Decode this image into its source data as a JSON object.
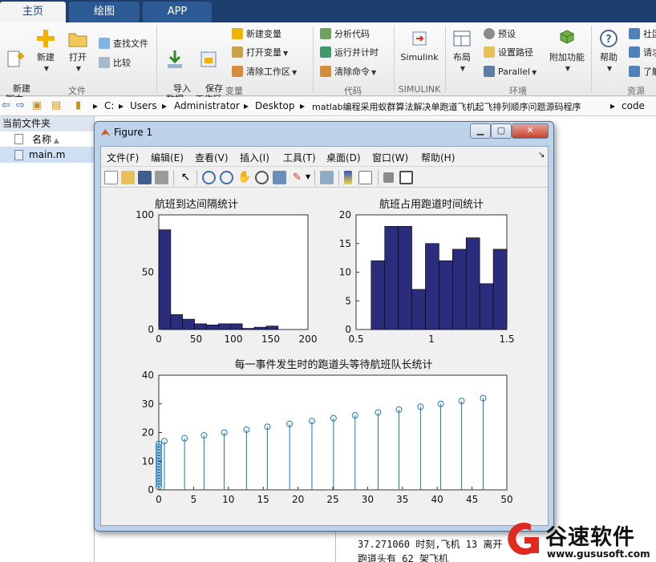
{
  "ribbon": {
    "tabs": [
      {
        "label": "主页",
        "active": true
      },
      {
        "label": "绘图",
        "active": false
      },
      {
        "label": "APP",
        "active": false
      }
    ],
    "buttons": {
      "new_script": "新建\n脚本",
      "new": "新建",
      "open": "打开",
      "find_files": "查找文件",
      "compare": "比较",
      "import_data": "导入\n数据",
      "save_workspace": "保存\n工作区",
      "new_variable": "新建变量",
      "open_variable": "打开变量",
      "clear_workspace": "清除工作区",
      "analyze_code": "分析代码",
      "run_and_time": "运行并计时",
      "clear_commands": "清除命令",
      "simulink": "Simulink",
      "layout": "布局",
      "preferences": "预设",
      "set_path": "设置路径",
      "parallel": "Parallel",
      "add_ons": "附加功能",
      "help": "帮助",
      "community": "社区",
      "request_support": "请求",
      "learn": "了解"
    },
    "groups": {
      "file": "文件",
      "variable": "变量",
      "code": "代码",
      "simulink": "SIMULINK",
      "environment": "环境",
      "resources": "资源"
    }
  },
  "address_bar": {
    "path": [
      "C:",
      "Users",
      "Administrator",
      "Desktop",
      "matlab编程采用蚁群算法解决单跑道飞机起飞排列顺序问题源码程序",
      "code"
    ]
  },
  "current_folder": {
    "title": "当前文件夹",
    "column_name": "名称",
    "files": [
      "main.m"
    ]
  },
  "command_window": {
    "lines": [
      "37.271060 时刻,飞机 13 离开",
      "跑道头有 62 架飞机"
    ]
  },
  "figure": {
    "title": "Figure 1",
    "menu": [
      "文件(F)",
      "编辑(E)",
      "查看(V)",
      "插入(I)",
      "工具(T)",
      "桌面(D)",
      "窗口(W)",
      "帮助(H)"
    ]
  },
  "watermark": {
    "brand": "谷速软件",
    "url": "www.gususoft.com"
  },
  "colors": {
    "tab_bar": "#1c3f6e",
    "bar_fill": "#2b2c7c",
    "stem": "#1f77b4"
  },
  "chart_data": [
    {
      "type": "bar",
      "title": "航班到达间隔统计",
      "xlim": [
        0,
        200
      ],
      "ylim": [
        0,
        100
      ],
      "xticks": [
        0,
        50,
        100,
        150,
        200
      ],
      "yticks": [
        0,
        50,
        100
      ],
      "bin_edges": [
        0,
        16,
        32,
        48,
        64,
        80,
        96,
        112,
        128,
        144,
        160
      ],
      "values": [
        87,
        13,
        9,
        5,
        4,
        5,
        5,
        1,
        2,
        3
      ]
    },
    {
      "type": "bar",
      "title": "航班占用跑道时间统计",
      "xlim": [
        0.5,
        1.5
      ],
      "ylim": [
        0,
        20
      ],
      "xticks": [
        0.5,
        1,
        1.5
      ],
      "yticks": [
        0,
        5,
        10,
        15,
        20
      ],
      "bin_edges": [
        0.6,
        0.69,
        0.78,
        0.87,
        0.96,
        1.05,
        1.14,
        1.23,
        1.32,
        1.41,
        1.5
      ],
      "values": [
        12,
        18,
        18,
        7,
        15,
        12,
        14,
        16,
        8,
        14
      ]
    },
    {
      "type": "stem",
      "title": "每一事件发生时的跑道头等待航班队长统计",
      "xlim": [
        0,
        50
      ],
      "ylim": [
        0,
        40
      ],
      "xticks": [
        0,
        5,
        10,
        15,
        20,
        25,
        30,
        35,
        40,
        45,
        50
      ],
      "yticks": [
        0,
        10,
        20,
        30,
        40
      ],
      "x": [
        0,
        0,
        0,
        0,
        0,
        0,
        0,
        0,
        0,
        0,
        0,
        0,
        0,
        0,
        0,
        0,
        0.8,
        3.7,
        6.5,
        9.4,
        12.6,
        15.6,
        18.8,
        22.0,
        25.1,
        28.2,
        31.5,
        34.5,
        37.6,
        40.5,
        43.5,
        46.6
      ],
      "y": [
        1,
        2,
        3,
        4,
        5,
        6,
        7,
        8,
        9,
        10,
        11,
        12,
        13,
        14,
        15,
        16,
        17,
        18,
        19,
        20,
        21,
        22,
        23,
        24,
        25,
        26,
        27,
        28,
        29,
        30,
        31,
        32
      ]
    }
  ]
}
